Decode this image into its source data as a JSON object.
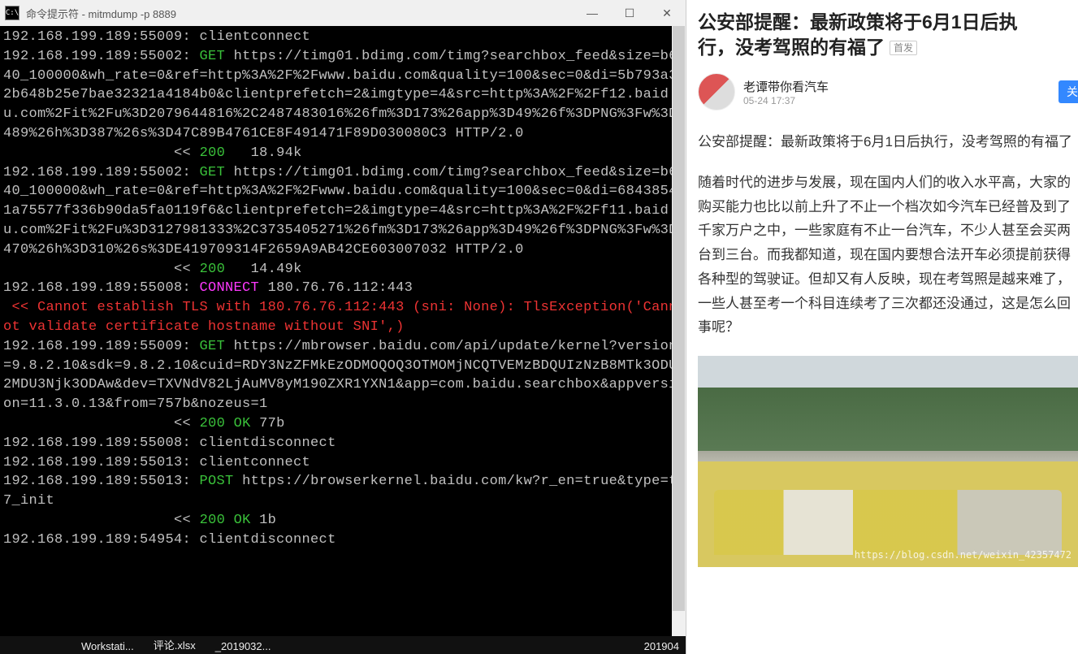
{
  "window": {
    "title": "命令提示符 - mitmdump  -p 8889",
    "icon_text": "C:\\"
  },
  "terminal": {
    "lines": [
      {
        "spans": [
          {
            "t": "192.168.199.189:55009: clientconnect",
            "c": "gray"
          }
        ]
      },
      {
        "spans": [
          {
            "t": "192.168.199.189:55002: ",
            "c": "gray"
          },
          {
            "t": "GET ",
            "c": "green"
          },
          {
            "t": "https://timg01.bdimg.com/timg?searchbox_feed&size=b640_100000&wh_rate=0&ref=http%3A%2F%2Fwww.baidu.com&quality=100&sec=0&di=5b793a32b648b25e7bae32321a4184b0&clientprefetch=2&imgtype=4&src=http%3A%2F%2Ff12.baidu.com%2Fit%2Fu%3D2079644816%2C2487483016%26fm%3D173%26app%3D49%26f%3DPNG%3Fw%3D489%26h%3D387%26s%3D47C89B4761CE8F491471F89D030080C3 HTTP/2.0",
            "c": "gray"
          }
        ]
      },
      {
        "spans": [
          {
            "t": "                    << ",
            "c": "gray"
          },
          {
            "t": "200",
            "c": "green"
          },
          {
            "t": "   18.94k",
            "c": "gray"
          }
        ]
      },
      {
        "spans": [
          {
            "t": "192.168.199.189:55002: ",
            "c": "gray"
          },
          {
            "t": "GET ",
            "c": "green"
          },
          {
            "t": "https://timg01.bdimg.com/timg?searchbox_feed&size=b640_100000&wh_rate=0&ref=http%3A%2F%2Fwww.baidu.com&quality=100&sec=0&di=68438541a75577f336b90da5fa0119f6&clientprefetch=2&imgtype=4&src=http%3A%2F%2Ff11.baidu.com%2Fit%2Fu%3D3127981333%2C3735405271%26fm%3D173%26app%3D49%26f%3DPNG%3Fw%3D470%26h%3D310%26s%3DE419709314F2659A9AB42CE603007032 HTTP/2.0",
            "c": "gray"
          }
        ]
      },
      {
        "spans": [
          {
            "t": "                    << ",
            "c": "gray"
          },
          {
            "t": "200",
            "c": "green"
          },
          {
            "t": "   14.49k",
            "c": "gray"
          }
        ]
      },
      {
        "spans": [
          {
            "t": "192.168.199.189:55008: ",
            "c": "gray"
          },
          {
            "t": "CONNECT ",
            "c": "magenta"
          },
          {
            "t": "180.76.76.112:443",
            "c": "gray"
          }
        ]
      },
      {
        "spans": [
          {
            "t": " << Cannot establish TLS with 180.76.76.112:443 (sni: None): TlsException('Cannot validate certificate hostname without SNI',)",
            "c": "red"
          }
        ]
      },
      {
        "spans": [
          {
            "t": "192.168.199.189:55009: ",
            "c": "gray"
          },
          {
            "t": "GET ",
            "c": "green"
          },
          {
            "t": "https://mbrowser.baidu.com/api/update/kernel?version=9.8.2.10&sdk=9.8.2.10&cuid=RDY3NzZFMkEzODMOQOQ3OTMOMjNCQTVEMzBDQUIzNzB8MTk3ODU2MDU3Njk3ODAw&dev=TXVNdV82LjAuMV8yM190ZXR1YXN1&app=com.baidu.searchbox&appversion=11.3.0.13&from=757b&nozeus=1",
            "c": "gray"
          }
        ]
      },
      {
        "spans": [
          {
            "t": "                    << ",
            "c": "gray"
          },
          {
            "t": "200 OK ",
            "c": "green"
          },
          {
            "t": "77b",
            "c": "gray"
          }
        ]
      },
      {
        "spans": [
          {
            "t": "192.168.199.189:55008: clientdisconnect",
            "c": "gray"
          }
        ]
      },
      {
        "spans": [
          {
            "t": "192.168.199.189:55013: clientconnect",
            "c": "gray"
          }
        ]
      },
      {
        "spans": [
          {
            "t": "192.168.199.189:55013: ",
            "c": "gray"
          },
          {
            "t": "POST ",
            "c": "green"
          },
          {
            "t": "https://browserkernel.baidu.com/kw?r_en=true&type=t7_init",
            "c": "gray"
          }
        ]
      },
      {
        "spans": [
          {
            "t": "                    << ",
            "c": "gray"
          },
          {
            "t": "200 OK ",
            "c": "green"
          },
          {
            "t": "1b",
            "c": "gray"
          }
        ]
      },
      {
        "spans": [
          {
            "t": "192.168.199.189:54954: clientdisconnect",
            "c": "gray"
          }
        ]
      }
    ]
  },
  "taskbar": {
    "items": [
      "Workstati...",
      "评论.xlsx",
      "_2019032..."
    ],
    "right": "201904"
  },
  "article": {
    "title_line1": "公安部提醒：最新政策将于6月1日后执",
    "title_line2": "行，没考驾照的有福了",
    "badge": "首发",
    "author": "老谭带你看汽车",
    "time": "05-24 17:37",
    "follow": "关",
    "para1": "公安部提醒：最新政策将于6月1日后执行，没考驾照的有福了",
    "para2": "随着时代的进步与发展，现在国内人们的收入水平高，大家的购买能力也比以前上升了不止一个档次如今汽车已经普及到了千家万户之中，一些家庭有不止一台汽车，不少人甚至会买两台到三台。而我都知道，现在国内要想合法开车必须提前获得各种型的驾驶证。但却又有人反映，现在考驾照是越来难了，一些人甚至考一个科目连续考了三次都还没通过，这是怎么回事呢？",
    "watermark": "https://blog.csdn.net/weixin_42357472"
  }
}
